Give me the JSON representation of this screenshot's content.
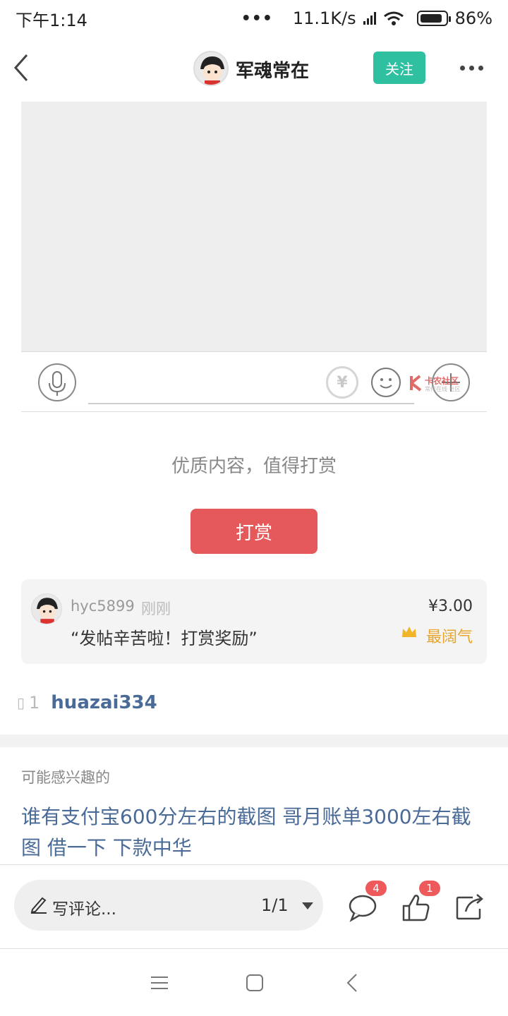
{
  "status_bar": {
    "time": "下午1:14",
    "speed": "11.1K/s",
    "battery": "86%"
  },
  "nav": {
    "title": "军魂常在",
    "follow_label": "关注"
  },
  "reward": {
    "tip": "优质内容，值得打赏",
    "button_label": "打赏",
    "record": {
      "user": "hyc5899",
      "time": "刚刚",
      "message": "“发帖辛苦啦！打赏奖励”",
      "amount": "¥3.00",
      "rank_label": "最阔气"
    }
  },
  "likes": {
    "count": "1",
    "users": "huazai334"
  },
  "related": {
    "heading": "可能感兴趣的",
    "link_text": "谁有支付宝600分左右的截图 哥月账单3000左右截图 借一下 下款中华"
  },
  "bottom_bar": {
    "comment_placeholder": "写评论...",
    "page_indicator": "1/1",
    "comment_badge": "4",
    "like_badge": "1"
  },
  "watermark": {
    "title": "卡农社区",
    "subtitle": "常伴在线 社区"
  },
  "colors": {
    "follow": "#2ec0a0",
    "reward_button": "#e5595a",
    "link": "#4a6a97",
    "rank": "#e7a52a",
    "badge": "#ee5a5b"
  }
}
